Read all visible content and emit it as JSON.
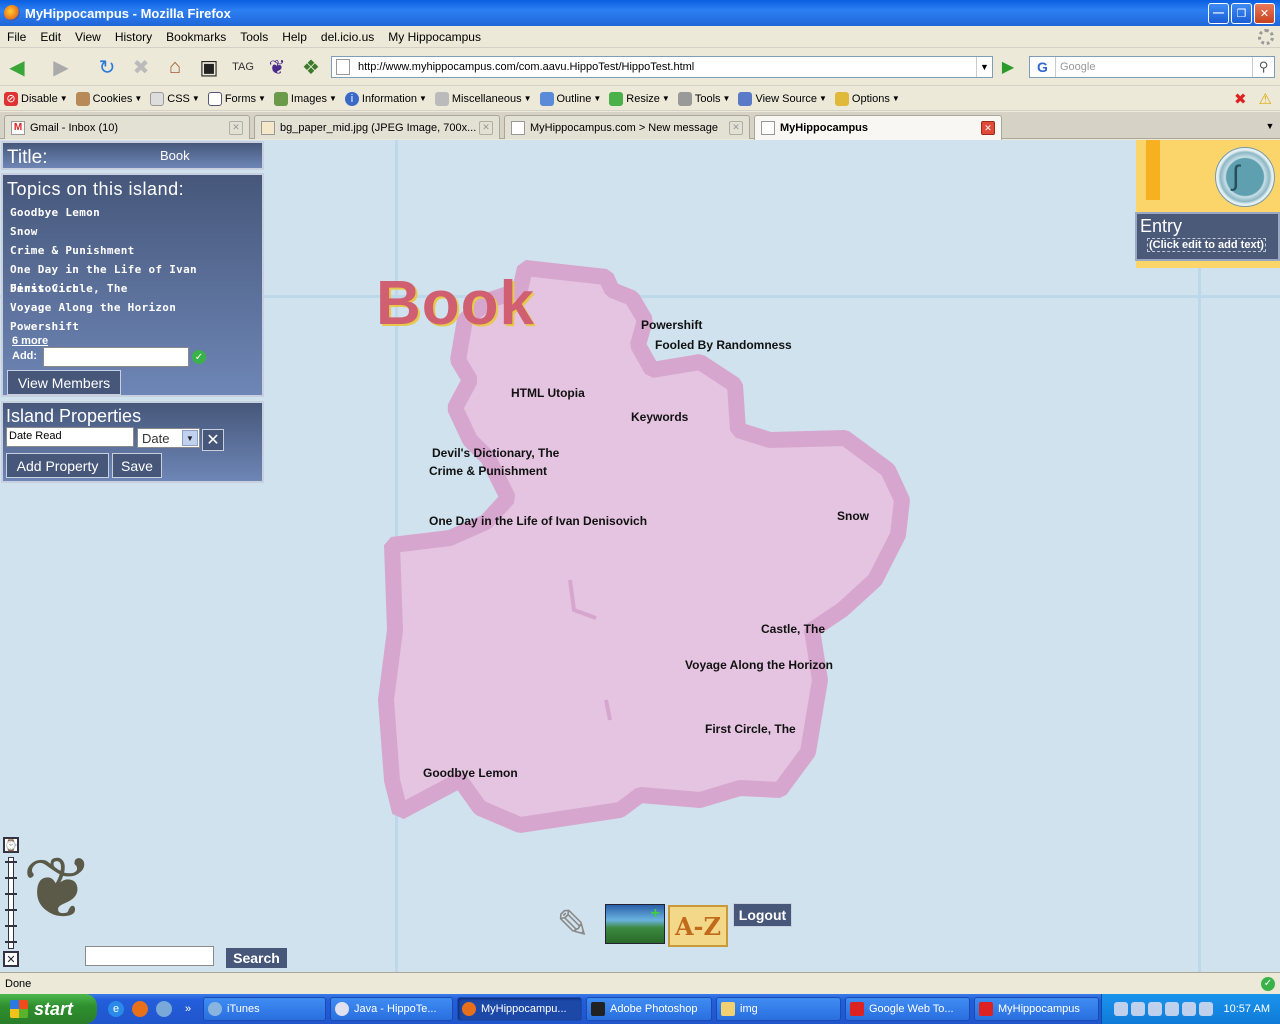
{
  "window": {
    "title": "MyHippocampus - Mozilla Firefox"
  },
  "menu": [
    "File",
    "Edit",
    "View",
    "History",
    "Bookmarks",
    "Tools",
    "Help",
    "del.icio.us",
    "My Hippocampus"
  ],
  "nav": {
    "url": "http://www.myhippocampus.com/com.aavu.HippoTest/HippoTest.html",
    "search_placeholder": "Google"
  },
  "devbar": [
    "Disable",
    "Cookies",
    "CSS",
    "Forms",
    "Images",
    "Information",
    "Miscellaneous",
    "Outline",
    "Resize",
    "Tools",
    "View Source",
    "Options"
  ],
  "tabs": [
    {
      "label": "Gmail - Inbox (10)"
    },
    {
      "label": "bg_paper_mid.jpg (JPEG Image, 700x..."
    },
    {
      "label": "MyHippocampus.com > New message"
    },
    {
      "label": "MyHippocampus"
    }
  ],
  "sidebar": {
    "title_label": "Title:",
    "title_value": "Book",
    "topics_heading": "Topics on this island:",
    "topics": [
      "Goodbye Lemon",
      "Snow",
      "Crime & Punishment",
      "One Day in the Life of Ivan Denisovich",
      "First Circle, The",
      "Voyage Along the Horizon",
      "Powershift"
    ],
    "more_link": "6 more",
    "add_label": "Add:",
    "view_members": "View Members",
    "props_heading": "Island Properties",
    "prop_name_value": "Date Read",
    "prop_type_value": "Date",
    "add_property": "Add Property",
    "save": "Save"
  },
  "island": {
    "title": "Book",
    "labels": [
      "Powershift",
      "Fooled By Randomness",
      "HTML Utopia",
      "Keywords",
      "Devil's Dictionary, The",
      "Crime & Punishment",
      "One Day in the Life of Ivan Denisovich",
      "Snow",
      "Castle, The",
      "Voyage Along the Horizon",
      "First Circle, The",
      "Goodbye Lemon"
    ]
  },
  "entry": {
    "title": "Entry",
    "subtitle": "(Click edit to add text)"
  },
  "bottom": {
    "search_button": "Search",
    "logout": "Logout",
    "az": "A-Z"
  },
  "status": {
    "text": "Done"
  },
  "taskbar": {
    "start": "start",
    "items": [
      "iTunes",
      "Java - HippoTe...",
      "MyHippocampu...",
      "Adobe Photoshop",
      "img",
      "Google Web To...",
      "MyHippocampus"
    ],
    "clock": "10:57 AM"
  },
  "colors": {
    "sea": "#cfe2ee",
    "island": "#e4c4e0",
    "island_border": "#d8a8d0",
    "panel": "#46577a",
    "title": "#d05f72"
  }
}
